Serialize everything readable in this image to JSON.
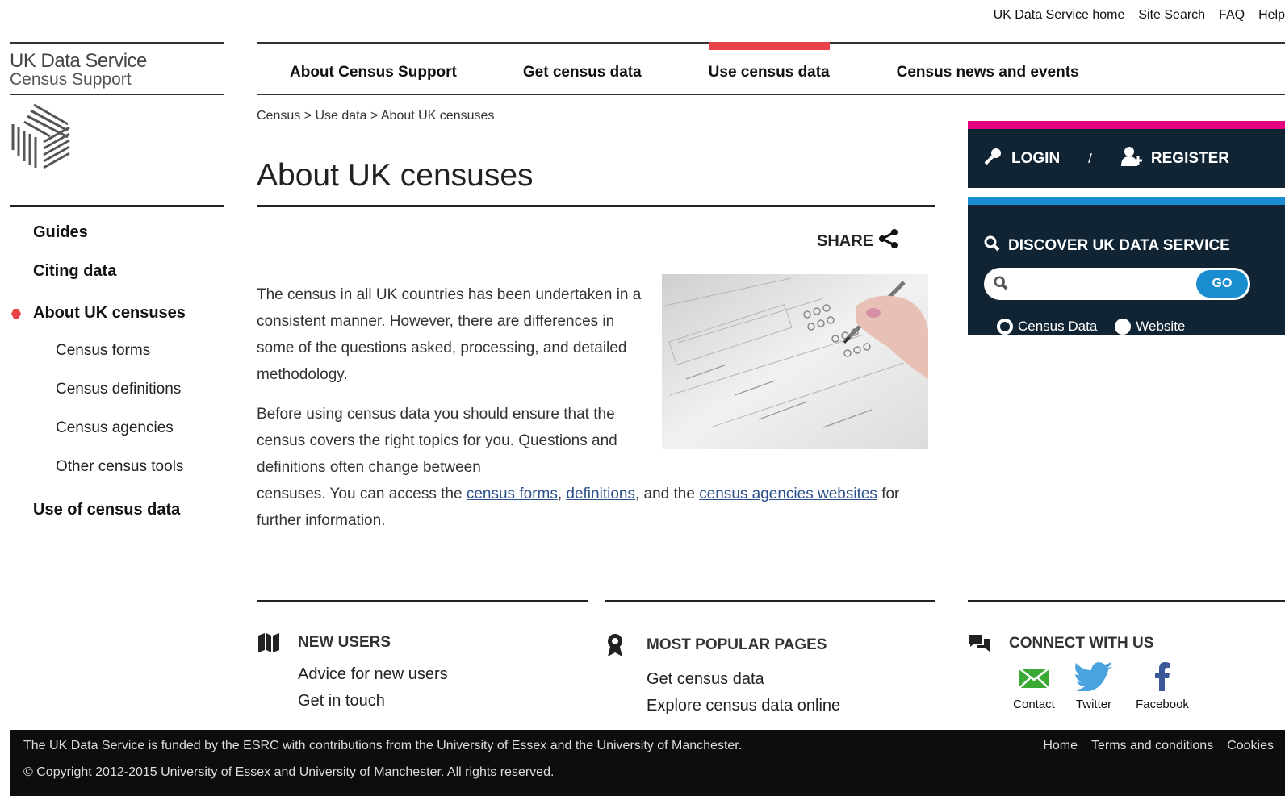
{
  "utility_nav": [
    "UK Data Service home",
    "Site Search",
    "FAQ",
    "Help"
  ],
  "logo": {
    "line1": "UK Data Service",
    "line2": "Census Support"
  },
  "top_nav": [
    {
      "label": "About Census Support",
      "active": false
    },
    {
      "label": "Get census data",
      "active": false
    },
    {
      "label": "Use census data",
      "active": true
    },
    {
      "label": "Census news and events",
      "active": false
    }
  ],
  "sidebar": {
    "top_items": [
      "Guides",
      "Citing data"
    ],
    "current": "About UK censuses",
    "sub_items": [
      "Census forms",
      "Census definitions",
      "Census agencies",
      "Other census tools"
    ],
    "bottom_item": "Use of census data"
  },
  "breadcrumb": "Census > Use data > About UK censuses",
  "page_title": "About UK censuses",
  "share_label": "SHARE",
  "content": {
    "para1": "The census in all UK countries has been undertaken in a consistent manner. However, there are differences in some of the questions asked, processing, and detailed methodology.",
    "para2_start": "Before using census data you should ensure that the census covers the right topics for you. Questions and definitions often change between",
    "para2_mid1": "censuses. You can access the ",
    "link_forms": "census forms",
    "sep1": ", ",
    "link_definitions": "definitions",
    "sep2": ", and the ",
    "link_agencies": "census agencies websites",
    "para2_end": " for further information."
  },
  "login": {
    "login_label": "LOGIN",
    "separator": "/",
    "register_label": "REGISTER"
  },
  "discover": {
    "title": "DISCOVER UK DATA SERVICE",
    "search_placeholder": "",
    "go_label": "GO",
    "radio_options": [
      {
        "label": "Census Data",
        "selected": true
      },
      {
        "label": "Website",
        "selected": false
      }
    ]
  },
  "footer_columns": {
    "new_users": {
      "title": "NEW USERS",
      "links": [
        "Advice for new users",
        "Get in touch"
      ]
    },
    "popular": {
      "title": "MOST POPULAR PAGES",
      "links": [
        "Get census data",
        "Explore census data online"
      ]
    },
    "connect": {
      "title": "CONNECT WITH US",
      "social": [
        "Contact",
        "Twitter",
        "Facebook"
      ]
    }
  },
  "footer": {
    "funding": "The UK Data Service is funded by the ESRC with contributions from the University of Essex and the University of Manchester.",
    "copyright": "© Copyright 2012-2015 University of Essex and University of Manchester. All rights reserved.",
    "links": [
      "Home",
      "Terms and conditions",
      "Cookies"
    ]
  },
  "colors": {
    "accent_red": "#e94249",
    "magenta": "#e5007e",
    "blue": "#1a8dd1",
    "navy": "#102433"
  },
  "icons": [
    "logo-mark-icon",
    "share-icon",
    "key-icon",
    "register-icon",
    "search-icon",
    "map-icon",
    "award-icon",
    "chat-icon",
    "mail-icon",
    "twitter-icon",
    "facebook-icon"
  ]
}
